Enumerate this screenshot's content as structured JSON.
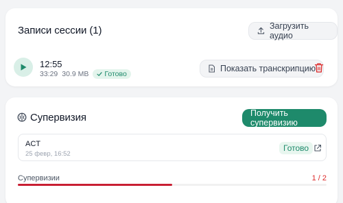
{
  "recordings": {
    "title": "Записи сессии (1)",
    "upload_label": "Загрузить аудио",
    "items": [
      {
        "time": "12:55",
        "duration": "33:29",
        "size": "30.9 MB",
        "status": "Готово",
        "transcript_label": "Показать транскрипцию"
      }
    ]
  },
  "supervision": {
    "title": "Супервизия",
    "get_label": "Получить супервизию",
    "items": [
      {
        "name": "ACT",
        "date": "25 февр, 16:52",
        "status": "Готово"
      }
    ],
    "progress": {
      "label": "Супервизии",
      "count": "1 / 2",
      "fraction": 0.5
    }
  },
  "colors": {
    "accent": "#1e8a6b",
    "danger": "#c81e32"
  }
}
